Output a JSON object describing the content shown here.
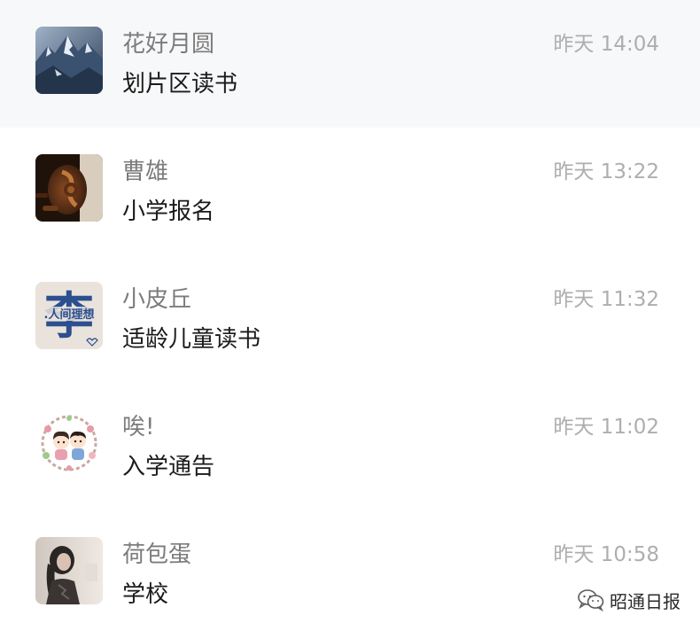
{
  "conversations": [
    {
      "name": "花好月圆",
      "message": "划片区读书",
      "time": "昨天 14:04",
      "avatar": "mountain-avatar",
      "selected": true
    },
    {
      "name": "曹雄",
      "message": "小学报名",
      "time": "昨天 13:22",
      "avatar": "violin-avatar",
      "selected": false
    },
    {
      "name": "小皮丘",
      "message": "适龄儿童读书",
      "time": "昨天 11:32",
      "avatar": "calligraphy-li-avatar",
      "avatar_text": "人间理想",
      "selected": false
    },
    {
      "name": "唉!",
      "message": "入学通告",
      "time": "昨天 11:02",
      "avatar": "cartoon-couple-avatar",
      "selected": false
    },
    {
      "name": "荷包蛋",
      "message": "学校",
      "time": "昨天 10:58",
      "avatar": "girl-photo-avatar",
      "selected": false
    }
  ],
  "watermark": {
    "icon": "wechat-logo-icon",
    "text": "昭通日报"
  },
  "colors": {
    "selected_row": "#f7f8f9",
    "name": "#7c7c7c",
    "message": "#1a1a1a",
    "time": "#aeaeae"
  }
}
